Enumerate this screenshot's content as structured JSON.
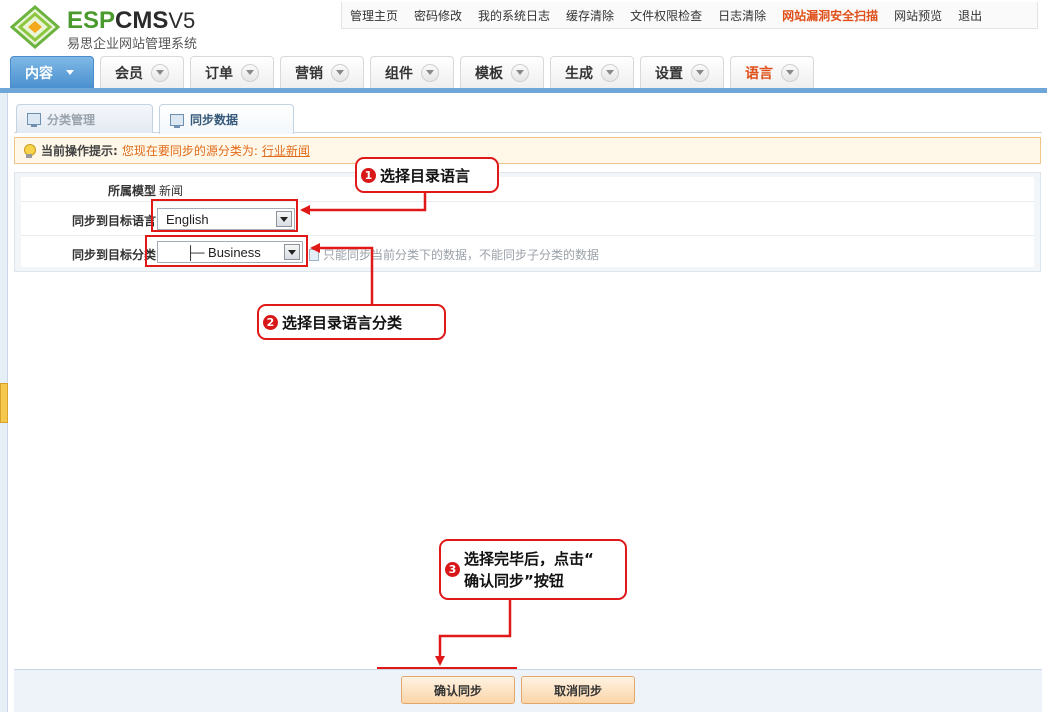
{
  "logo": {
    "brand_esp": "ESP",
    "brand_cms": "CMS",
    "brand_version": "V5",
    "subtitle": "易思企业网站管理系统"
  },
  "topnav": {
    "items": [
      "管理主页",
      "密码修改",
      "我的系统日志",
      "缓存清除",
      "文件权限检查",
      "日志清除",
      "网站漏洞安全扫描",
      "网站预览",
      "退出"
    ],
    "highlight_color": "#e0501a"
  },
  "mainnav": {
    "tabs": [
      "内容",
      "会员",
      "订单",
      "营销",
      "组件",
      "模板",
      "生成",
      "设置",
      "语言"
    ],
    "active": "内容",
    "active_color": "#4a90cf"
  },
  "subtabs": [
    "分类管理",
    "同步数据"
  ],
  "tip": {
    "label": "当前操作提示:",
    "text": "您现在要同步的源分类为:",
    "link": "行业新闻"
  },
  "form": {
    "model_label": "所属模型",
    "model_value": "新闻",
    "lang_label": "同步到目标语言",
    "lang_value": "English",
    "cat_label": "同步到目标分类",
    "cat_value": "├─ Business",
    "cat_hint": "只能同步当前分类下的数据，不能同步子分类的数据"
  },
  "callouts": {
    "c1_num": "1",
    "c1_text": "选择目录语言",
    "c2_num": "2",
    "c2_text": "选择目录语言分类",
    "c3_num": "3",
    "c3_line1": "选择完毕后，点击“",
    "c3_line2": "确认同步”按钮"
  },
  "buttons": {
    "confirm": "确认同步",
    "cancel": "取消同步"
  }
}
